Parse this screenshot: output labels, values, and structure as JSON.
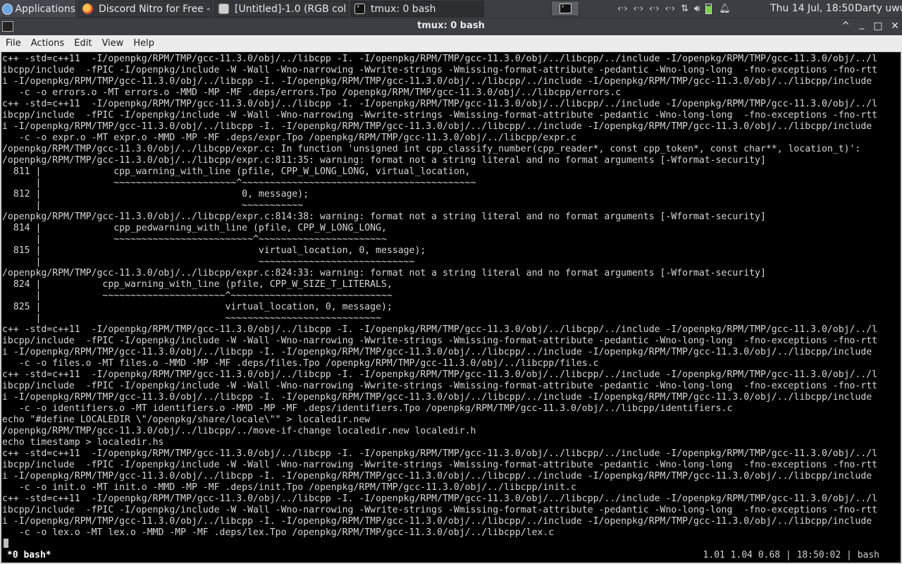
{
  "panel": {
    "applications_label": "Applications",
    "tasks": [
      {
        "label": "Discord Nitro for Free -...",
        "icon": "firefox-icon"
      },
      {
        "label": "[Untitled]-1.0 (RGB col...",
        "icon": "gimp-icon"
      },
      {
        "label": "tmux: 0 bash",
        "icon": "terminal-icon"
      }
    ],
    "tray_icons": [
      "network-icon",
      "network-icon",
      "network-icon",
      "network-icon",
      "updown-arrows-icon",
      "volume-icon",
      "battery-icon",
      "bell-icon"
    ],
    "clock": "Thu 14 Jul, 18:50",
    "user": "Darty uwu"
  },
  "window": {
    "title": "tmux: 0 bash",
    "buttons": {
      "restore": "^",
      "minimize": "_",
      "maximize": "□",
      "close": "✕"
    }
  },
  "menu": [
    "File",
    "Actions",
    "Edit",
    "View",
    "Help"
  ],
  "terminal": {
    "lines": [
      "c++ -std=c++11  -I/openpkg/RPM/TMP/gcc-11.3.0/obj/../libcpp -I. -I/openpkg/RPM/TMP/gcc-11.3.0/obj/../libcpp/../include -I/openpkg/RPM/TMP/gcc-11.3.0/obj/../l",
      "ibcpp/include  -fPIC -I/openpkg/include -W -Wall -Wno-narrowing -Wwrite-strings -Wmissing-format-attribute -pedantic -Wno-long-long  -fno-exceptions -fno-rtt",
      "i -I/openpkg/RPM/TMP/gcc-11.3.0/obj/../libcpp -I. -I/openpkg/RPM/TMP/gcc-11.3.0/obj/../libcpp/../include -I/openpkg/RPM/TMP/gcc-11.3.0/obj/../libcpp/include",
      "   -c -o errors.o -MT errors.o -MMD -MP -MF .deps/errors.Tpo /openpkg/RPM/TMP/gcc-11.3.0/obj/../libcpp/errors.c",
      "c++ -std=c++11  -I/openpkg/RPM/TMP/gcc-11.3.0/obj/../libcpp -I. -I/openpkg/RPM/TMP/gcc-11.3.0/obj/../libcpp/../include -I/openpkg/RPM/TMP/gcc-11.3.0/obj/../l",
      "ibcpp/include  -fPIC -I/openpkg/include -W -Wall -Wno-narrowing -Wwrite-strings -Wmissing-format-attribute -pedantic -Wno-long-long  -fno-exceptions -fno-rtt",
      "i -I/openpkg/RPM/TMP/gcc-11.3.0/obj/../libcpp -I. -I/openpkg/RPM/TMP/gcc-11.3.0/obj/../libcpp/../include -I/openpkg/RPM/TMP/gcc-11.3.0/obj/../libcpp/include",
      "   -c -o expr.o -MT expr.o -MMD -MP -MF .deps/expr.Tpo /openpkg/RPM/TMP/gcc-11.3.0/obj/../libcpp/expr.c",
      "/openpkg/RPM/TMP/gcc-11.3.0/obj/../libcpp/expr.c: In function 'unsigned int cpp_classify_number(cpp_reader*, const cpp_token*, const char**, location_t)':",
      "/openpkg/RPM/TMP/gcc-11.3.0/obj/../libcpp/expr.c:811:35: warning: format not a string literal and no format arguments [-Wformat-security]",
      "  811 |             cpp_warning_with_line (pfile, CPP_W_LONG_LONG, virtual_location,",
      "      |             ~~~~~~~~~~~~~~~~~~~~~~^~~~~~~~~~~~~~~~~~~~~~~~~~~~~~~~~~~~~~~~~~~",
      "  812 |                                    0, message);",
      "      |                                    ~~~~~~~~~~~",
      "/openpkg/RPM/TMP/gcc-11.3.0/obj/../libcpp/expr.c:814:38: warning: format not a string literal and no format arguments [-Wformat-security]",
      "  814 |             cpp_pedwarning_with_line (pfile, CPP_W_LONG_LONG,",
      "      |             ~~~~~~~~~~~~~~~~~~~~~~~~~^~~~~~~~~~~~~~~~~~~~~~~~",
      "  815 |                                       virtual_location, 0, message);",
      "      |                                       ~~~~~~~~~~~~~~~~~~~~~~~~~~~~",
      "/openpkg/RPM/TMP/gcc-11.3.0/obj/../libcpp/expr.c:824:33: warning: format not a string literal and no format arguments [-Wformat-security]",
      "  824 |           cpp_warning_with_line (pfile, CPP_W_SIZE_T_LITERALS,",
      "      |           ~~~~~~~~~~~~~~~~~~~~~~^~~~~~~~~~~~~~~~~~~~~~~~~~~~~~",
      "  825 |                                 virtual_location, 0, message);",
      "      |                                 ~~~~~~~~~~~~~~~~~~~~~~~~~~~~",
      "c++ -std=c++11  -I/openpkg/RPM/TMP/gcc-11.3.0/obj/../libcpp -I. -I/openpkg/RPM/TMP/gcc-11.3.0/obj/../libcpp/../include -I/openpkg/RPM/TMP/gcc-11.3.0/obj/../l",
      "ibcpp/include  -fPIC -I/openpkg/include -W -Wall -Wno-narrowing -Wwrite-strings -Wmissing-format-attribute -pedantic -Wno-long-long  -fno-exceptions -fno-rtt",
      "i -I/openpkg/RPM/TMP/gcc-11.3.0/obj/../libcpp -I. -I/openpkg/RPM/TMP/gcc-11.3.0/obj/../libcpp/../include -I/openpkg/RPM/TMP/gcc-11.3.0/obj/../libcpp/include",
      "   -c -o files.o -MT files.o -MMD -MP -MF .deps/files.Tpo /openpkg/RPM/TMP/gcc-11.3.0/obj/../libcpp/files.c",
      "c++ -std=c++11  -I/openpkg/RPM/TMP/gcc-11.3.0/obj/../libcpp -I. -I/openpkg/RPM/TMP/gcc-11.3.0/obj/../libcpp/../include -I/openpkg/RPM/TMP/gcc-11.3.0/obj/../l",
      "ibcpp/include  -fPIC -I/openpkg/include -W -Wall -Wno-narrowing -Wwrite-strings -Wmissing-format-attribute -pedantic -Wno-long-long  -fno-exceptions -fno-rtt",
      "i -I/openpkg/RPM/TMP/gcc-11.3.0/obj/../libcpp -I. -I/openpkg/RPM/TMP/gcc-11.3.0/obj/../libcpp/../include -I/openpkg/RPM/TMP/gcc-11.3.0/obj/../libcpp/include",
      "   -c -o identifiers.o -MT identifiers.o -MMD -MP -MF .deps/identifiers.Tpo /openpkg/RPM/TMP/gcc-11.3.0/obj/../libcpp/identifiers.c",
      "echo \"#define LOCALEDIR \\\"/openpkg/share/locale\\\"\" > localedir.new",
      "/openpkg/RPM/TMP/gcc-11.3.0/obj/../libcpp/../move-if-change localedir.new localedir.h",
      "echo timestamp > localedir.hs",
      "c++ -std=c++11  -I/openpkg/RPM/TMP/gcc-11.3.0/obj/../libcpp -I. -I/openpkg/RPM/TMP/gcc-11.3.0/obj/../libcpp/../include -I/openpkg/RPM/TMP/gcc-11.3.0/obj/../l",
      "ibcpp/include  -fPIC -I/openpkg/include -W -Wall -Wno-narrowing -Wwrite-strings -Wmissing-format-attribute -pedantic -Wno-long-long  -fno-exceptions -fno-rtt",
      "i -I/openpkg/RPM/TMP/gcc-11.3.0/obj/../libcpp -I. -I/openpkg/RPM/TMP/gcc-11.3.0/obj/../libcpp/../include -I/openpkg/RPM/TMP/gcc-11.3.0/obj/../libcpp/include",
      "   -c -o init.o -MT init.o -MMD -MP -MF .deps/init.Tpo /openpkg/RPM/TMP/gcc-11.3.0/obj/../libcpp/init.c",
      "c++ -std=c++11  -I/openpkg/RPM/TMP/gcc-11.3.0/obj/../libcpp -I. -I/openpkg/RPM/TMP/gcc-11.3.0/obj/../libcpp/../include -I/openpkg/RPM/TMP/gcc-11.3.0/obj/../l",
      "ibcpp/include  -fPIC -I/openpkg/include -W -Wall -Wno-narrowing -Wwrite-strings -Wmissing-format-attribute -pedantic -Wno-long-long  -fno-exceptions -fno-rtt",
      "i -I/openpkg/RPM/TMP/gcc-11.3.0/obj/../libcpp -I. -I/openpkg/RPM/TMP/gcc-11.3.0/obj/../libcpp/../include -I/openpkg/RPM/TMP/gcc-11.3.0/obj/../libcpp/include",
      "   -c -o lex.o -MT lex.o -MMD -MP -MF .deps/lex.Tpo /openpkg/RPM/TMP/gcc-11.3.0/obj/../libcpp/lex.c"
    ]
  },
  "status": {
    "window": "*0 bash*",
    "right": "1.01 1.04 0.68 | 18:50:02 | bash"
  },
  "colors": {
    "panel_bg": "#3b3e43",
    "menu_bg": "#ececec",
    "terminal_bg": "#000000",
    "terminal_fg": "#d6d6d6",
    "battery_green": "#7ad04a"
  }
}
